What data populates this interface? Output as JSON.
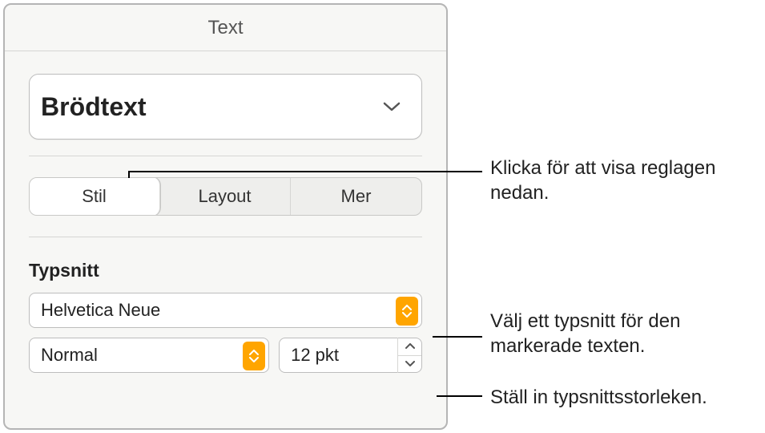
{
  "panel": {
    "title": "Text",
    "paragraph_style": "Brödtext",
    "tabs": {
      "style": "Stil",
      "layout": "Layout",
      "more": "Mer"
    },
    "font": {
      "section_label": "Typsnitt",
      "family": "Helvetica Neue",
      "weight": "Normal",
      "size": "12 pkt"
    }
  },
  "callouts": {
    "tabs": "Klicka för att visa reglagen nedan.",
    "font": "Välj ett typsnitt för den markerade texten.",
    "size": "Ställ in typsnittsstorleken."
  }
}
